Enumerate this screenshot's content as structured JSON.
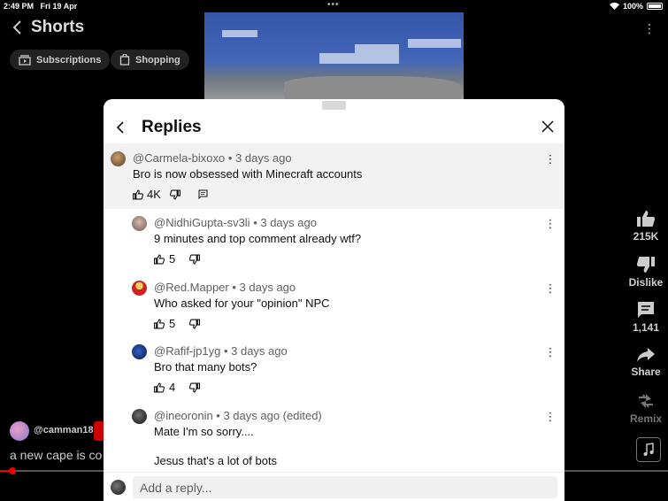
{
  "status_bar": {
    "time": "2:49 PM",
    "date": "Fri 19 Apr",
    "battery": "100%"
  },
  "header": {
    "title": "Shorts"
  },
  "chips": [
    {
      "label": "Subscriptions",
      "icon": "subscriptions-icon"
    },
    {
      "label": "Shopping",
      "icon": "shopping-bag-icon"
    }
  ],
  "rail": {
    "like_count": "215K",
    "dislike_label": "Dislike",
    "comment_count": "1,141",
    "share_label": "Share",
    "remix_label": "Remix"
  },
  "channel": {
    "name": "@camman18",
    "caption": "a new cape is co"
  },
  "sheet": {
    "title": "Replies",
    "reply_placeholder": "Add a reply...",
    "parent_comment": {
      "author": "@Carmela-bixoxo",
      "time": "3 days ago",
      "text": "Bro is now obsessed with Minecraft accounts",
      "likes": "4K"
    },
    "replies": [
      {
        "author": "@NidhiGupta-sv3li",
        "time": "3 days ago",
        "text": "9 minutes and top comment already wtf?",
        "likes": "5"
      },
      {
        "author": "@Red.Mapper",
        "time": "3 days ago",
        "text": "Who asked for your \"opinion\" NPC",
        "likes": "5"
      },
      {
        "author": "@Rafif-jp1yg",
        "time": "3 days ago",
        "text": "Bro that many bots?",
        "likes": "4"
      },
      {
        "author": "@ineoronin",
        "time": "3 days ago (edited)",
        "text_line1": "Mate I'm so sorry....",
        "text_line2": "Jesus that's a lot of bots"
      }
    ]
  }
}
